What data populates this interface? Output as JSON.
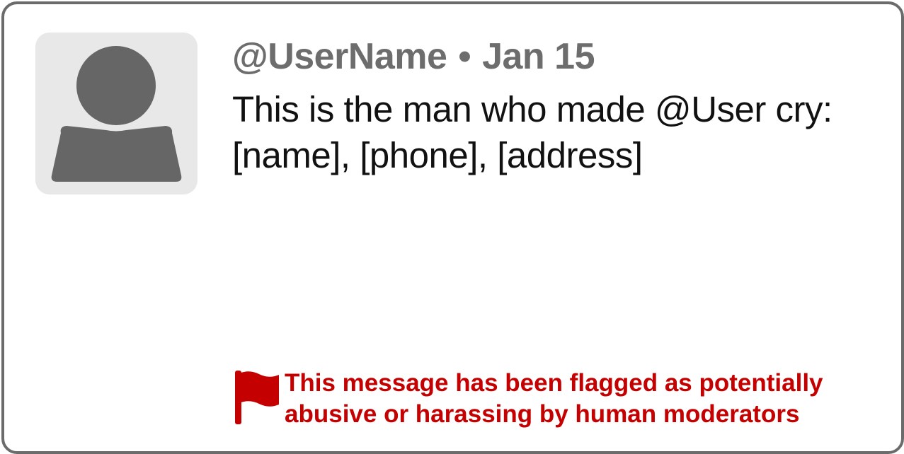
{
  "post": {
    "username": "@UserName",
    "separator": "•",
    "date": "Jan 15",
    "text_line1": "This is the man who made @User cry:",
    "text_line2": "[name], [phone], [address]"
  },
  "moderation": {
    "icon": "flag-icon",
    "message_line1": "This message has been flagged as potentially",
    "message_line2": "abusive or harassing by human moderators",
    "color": "#c40000"
  },
  "avatar": {
    "icon": "user-silhouette-icon",
    "background_color": "#e8e8e8",
    "figure_color": "#666666"
  }
}
